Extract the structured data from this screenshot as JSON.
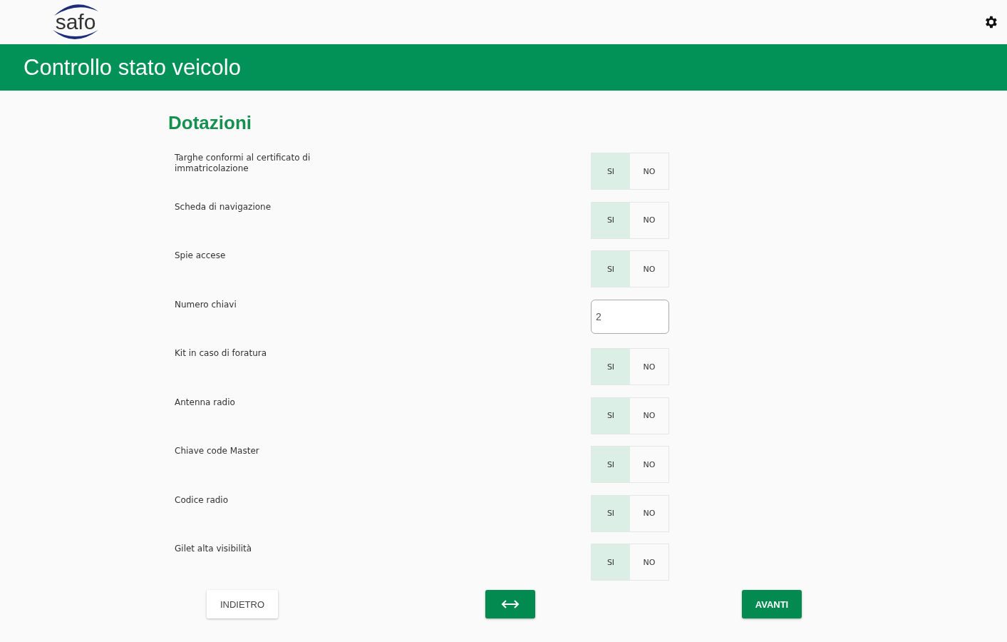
{
  "header": {
    "logo": "safo"
  },
  "title": "Controllo stato veicolo",
  "section": "Dotazioni",
  "items": [
    {
      "kind": "toggle",
      "label": "Targhe conformi al certificato di immatricolazione",
      "options": [
        {
          "label": "SI",
          "selected": true
        },
        {
          "label": "NO",
          "selected": false
        }
      ]
    },
    {
      "kind": "toggle",
      "label": "Scheda di navigazione",
      "options": [
        {
          "label": "SI",
          "selected": true
        },
        {
          "label": "NO",
          "selected": false
        }
      ]
    },
    {
      "kind": "toggle",
      "label": "Spie  accese",
      "options": [
        {
          "label": "SI",
          "selected": true
        },
        {
          "label": "NO",
          "selected": false
        }
      ]
    },
    {
      "kind": "number",
      "label": "Numero chiavi",
      "value": "2"
    },
    {
      "kind": "toggle",
      "label": "Kit in caso di foratura",
      "options": [
        {
          "label": "SI",
          "selected": true
        },
        {
          "label": "NO",
          "selected": false
        }
      ]
    },
    {
      "kind": "toggle",
      "label": "Antenna radio",
      "options": [
        {
          "label": "SI",
          "selected": true
        },
        {
          "label": "NO",
          "selected": false
        }
      ]
    },
    {
      "kind": "toggle",
      "label": "Chiave code Master",
      "options": [
        {
          "label": "SI",
          "selected": true
        },
        {
          "label": "NO",
          "selected": false
        }
      ]
    },
    {
      "kind": "toggle",
      "label": "Codice radio",
      "options": [
        {
          "label": "SI",
          "selected": true
        },
        {
          "label": "NO",
          "selected": false
        }
      ]
    },
    {
      "kind": "toggle",
      "label": "Gilet alta visibilità",
      "options": [
        {
          "label": "SI",
          "selected": true
        },
        {
          "label": "NO",
          "selected": false
        }
      ]
    }
  ],
  "footer": {
    "back": "INDIETRO",
    "next": "AVANTI"
  }
}
